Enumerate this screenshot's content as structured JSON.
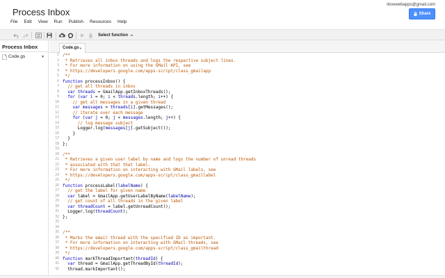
{
  "app": {
    "title": "Process Inbox",
    "account": "ilovewebapps@gmail.com",
    "share_label": "Share"
  },
  "menus": [
    "File",
    "Edit",
    "View",
    "Run",
    "Publish",
    "Resources",
    "Help"
  ],
  "toolbar": {
    "select_function": "Select function"
  },
  "sidebar": {
    "title": "Process Inbox",
    "file": "Code.gs"
  },
  "editor": {
    "tab": "Code.gs",
    "colors": {
      "keyword": "#0000cc",
      "comment": "#bb5500",
      "variable": "#000000",
      "param": "#0000aa",
      "line_number": "#999999"
    }
  },
  "code_lines": [
    {
      "n": "1",
      "text": "/**",
      "kind": "comment"
    },
    {
      "n": "2",
      "text": " * Retrieves all inbox threads and logs the respective subject lines.",
      "kind": "comment"
    },
    {
      "n": "3",
      "text": " * For more information on using the GMail API, see",
      "kind": "comment"
    },
    {
      "n": "4",
      "text": " * https://developers.google.com/apps-script/class_gmailapp",
      "kind": "comment"
    },
    {
      "n": "5",
      "text": " */",
      "kind": "comment"
    },
    {
      "n": "6",
      "text": "function processInbox() {",
      "kind": "code"
    },
    {
      "n": "7",
      "text": "  // get all threads in inbox",
      "kind": "comment"
    },
    {
      "n": "8",
      "text": "  var threads = GmailApp.getInboxThreads();",
      "kind": "code"
    },
    {
      "n": "9",
      "text": "  for (var i = 0; i < threads.length; i++) {",
      "kind": "code"
    },
    {
      "n": "10",
      "text": "    // get all messages in a given thread",
      "kind": "comment"
    },
    {
      "n": "11",
      "text": "    var messages = threads[i].getMessages();",
      "kind": "code"
    },
    {
      "n": "12",
      "text": "    // iterate over each message",
      "kind": "comment"
    },
    {
      "n": "13",
      "text": "    for (var j = 0; j < messages.length; j++) {",
      "kind": "code"
    },
    {
      "n": "14",
      "text": "      // log message subject",
      "kind": "comment"
    },
    {
      "n": "15",
      "text": "      Logger.log(messages[j].getSubject());",
      "kind": "code"
    },
    {
      "n": "16",
      "text": "    }",
      "kind": "code"
    },
    {
      "n": "17",
      "text": "  }",
      "kind": "code"
    },
    {
      "n": "18",
      "text": "};",
      "kind": "code"
    },
    {
      "n": "19",
      "text": "",
      "kind": "code"
    },
    {
      "n": "20",
      "text": "/**",
      "kind": "comment"
    },
    {
      "n": "21",
      "text": " * Retrieves a given user label by name and logs the number of unread threads",
      "kind": "comment"
    },
    {
      "n": "22",
      "text": " * associated with that that label.",
      "kind": "comment"
    },
    {
      "n": "23",
      "text": " * For more information on interacting with GMail labels, see",
      "kind": "comment"
    },
    {
      "n": "24",
      "text": " * https://developers.google.com/apps-script/class_gmaillabel",
      "kind": "comment"
    },
    {
      "n": "25",
      "text": " */",
      "kind": "comment"
    },
    {
      "n": "26",
      "text": "function processLabel(labelName) {",
      "kind": "code"
    },
    {
      "n": "27",
      "text": "  // get the label for given name",
      "kind": "comment"
    },
    {
      "n": "28",
      "text": "  var label = GmailApp.getUserLabelByName(labelName);",
      "kind": "code"
    },
    {
      "n": "29",
      "text": "  // get count of all threads in the given label",
      "kind": "comment"
    },
    {
      "n": "30",
      "text": "  var threadCount = label.getUnreadCount();",
      "kind": "code"
    },
    {
      "n": "31",
      "text": "  Logger.log(threadCount);",
      "kind": "code"
    },
    {
      "n": "32",
      "text": "};",
      "kind": "code"
    },
    {
      "n": "33",
      "text": "",
      "kind": "code"
    },
    {
      "n": "34",
      "text": "",
      "kind": "code"
    },
    {
      "n": "35",
      "text": "/**",
      "kind": "comment"
    },
    {
      "n": "36",
      "text": " * Marks the email thread with the specified ID as important.",
      "kind": "comment"
    },
    {
      "n": "37",
      "text": " * For more information on interacting with GMail threads, see",
      "kind": "comment"
    },
    {
      "n": "38",
      "text": " * https://developers.google.com/apps-script/class_gmailthread",
      "kind": "comment"
    },
    {
      "n": "39",
      "text": " */",
      "kind": "comment"
    },
    {
      "n": "40",
      "text": "function markThreadImportant(threadId) {",
      "kind": "code"
    },
    {
      "n": "41",
      "text": "  var thread = GmailApp.getThreadById(threadId);",
      "kind": "code"
    },
    {
      "n": "42",
      "text": "  thread.markImportant();",
      "kind": "code"
    }
  ]
}
